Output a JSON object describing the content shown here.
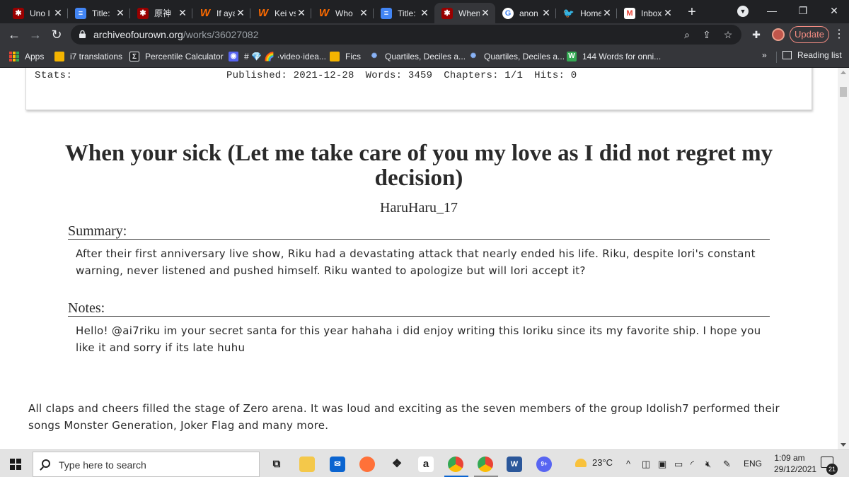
{
  "tabs": [
    {
      "title": "Uno I",
      "favicon": "ao3-icon"
    },
    {
      "title": "Title:",
      "favicon": "docs-icon"
    },
    {
      "title": "原神",
      "favicon": "ao3-icon"
    },
    {
      "title": "If aya",
      "favicon": "wattpad-icon"
    },
    {
      "title": "Kei vs",
      "favicon": "wattpad-icon"
    },
    {
      "title": "Who",
      "favicon": "wattpad-icon"
    },
    {
      "title": "Title:",
      "favicon": "docs-icon"
    },
    {
      "title": "When",
      "favicon": "ao3-icon",
      "active": true
    },
    {
      "title": "anon",
      "favicon": "google-icon"
    },
    {
      "title": "Home",
      "favicon": "twitter-icon"
    },
    {
      "title": "Inbox",
      "favicon": "gmail-icon"
    }
  ],
  "address": {
    "domain": "archiveofourown.org",
    "path": "/works/36027082",
    "update_label": "Update"
  },
  "bookmarks": {
    "items": [
      {
        "label": "Apps"
      },
      {
        "label": "i7 translations"
      },
      {
        "label": "Percentile Calculator"
      },
      {
        "label": "# 💎 🌈 ·video·idea..."
      },
      {
        "label": "Fics"
      },
      {
        "label": "Quartiles, Deciles a..."
      },
      {
        "label": "Quartiles, Deciles a..."
      },
      {
        "label": "144 Words for onni..."
      }
    ],
    "more": "»",
    "reading_list": "Reading list"
  },
  "work": {
    "stats_label": "Stats:",
    "published": "Published: 2021-12-28",
    "words": "Words: 3459",
    "chapters": "Chapters: 1/1",
    "hits": "Hits: 0",
    "title": "When your sick (Let me take care of you my love as I did not regret my decision)",
    "author": "HaruHaru_17",
    "summary_heading": "Summary:",
    "summary": "After their first anniversary live show, Riku had a devastating attack that nearly ended his life. Riku, despite Iori's constant warning, never listened and pushed himself. Riku wanted to apologize but will Iori accept it?",
    "notes_heading": "Notes:",
    "notes": "Hello! @ai7riku im your secret santa for this year hahaha i did enjoy writing this Ioriku since its my favorite ship. I hope you like it and sorry if its late huhu",
    "chapter_text": "All claps and cheers filled the stage of Zero arena. It was loud and exciting as the seven  members of the group Idolish7 performed their songs Monster Generation, Joker Flag and many more."
  },
  "taskbar": {
    "search_placeholder": "Type here to search",
    "weather": "23°C",
    "language": "ENG",
    "time": "1:09 am",
    "date": "29/12/2021",
    "notifications": "21",
    "discord_badge": "9+"
  },
  "colors": {
    "chrome_dark": "#202124",
    "chrome_toolbar": "#35363a",
    "update_accent": "#f28b82",
    "ao3_red": "#990000"
  }
}
